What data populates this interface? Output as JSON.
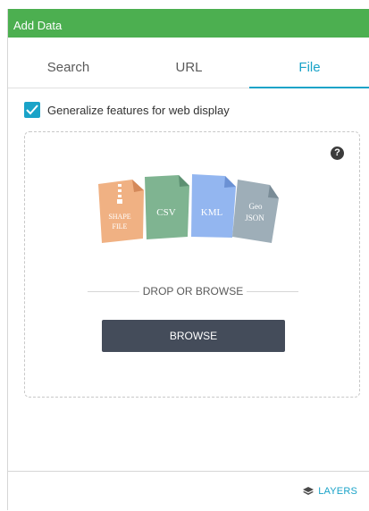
{
  "title": "Add Data",
  "tabs": [
    {
      "label": "Search",
      "active": false
    },
    {
      "label": "URL",
      "active": false
    },
    {
      "label": "File",
      "active": true
    }
  ],
  "options": {
    "generalize_label": "Generalize features for web display",
    "generalize_checked": true
  },
  "dropzone": {
    "help": "?",
    "file_types": [
      "SHAPE FILE",
      "CSV",
      "KML",
      "Geo JSON"
    ],
    "divider_text": "DROP OR BROWSE",
    "browse_label": "BROWSE"
  },
  "footer": {
    "layers_label": "LAYERS",
    "layers_icon": "layers-icon"
  },
  "colors": {
    "accent": "#1aa3c8",
    "header": "#4caf50",
    "button": "#444c5a",
    "shapefile": "#f0b183",
    "csv": "#7fb491",
    "kml": "#93b6f0",
    "geojson": "#9eaeb8"
  }
}
